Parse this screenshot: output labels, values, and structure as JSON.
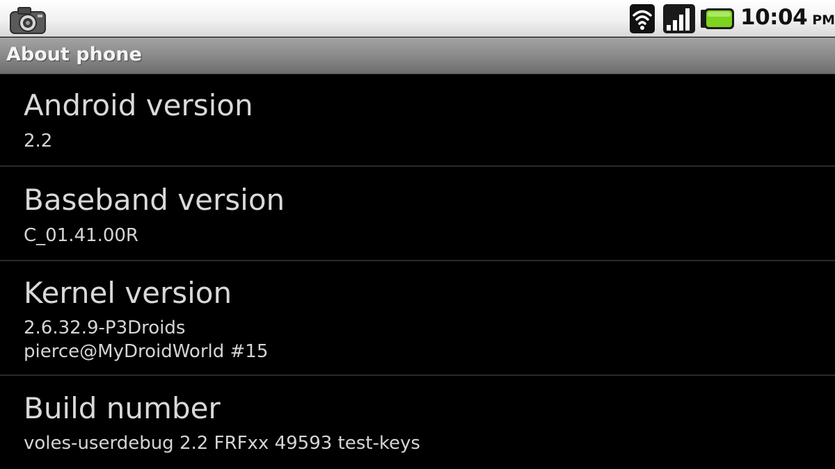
{
  "status_bar": {
    "time": "10:04",
    "ampm": "PM",
    "notification_icon": "camera-icon",
    "icons": [
      "wifi-icon",
      "signal-icon",
      "battery-icon"
    ],
    "battery_color": "#7ed321"
  },
  "title_bar": {
    "title": "About phone"
  },
  "items": [
    {
      "title": "Android version",
      "summary": [
        "2.2"
      ]
    },
    {
      "title": "Baseband version",
      "summary": [
        "C_01.41.00R"
      ]
    },
    {
      "title": "Kernel version",
      "summary": [
        "2.6.32.9-P3Droids",
        "pierce@MyDroidWorld #15"
      ]
    },
    {
      "title": "Build number",
      "summary": [
        "voles-userdebug 2.2 FRFxx 49593 test-keys"
      ]
    }
  ]
}
